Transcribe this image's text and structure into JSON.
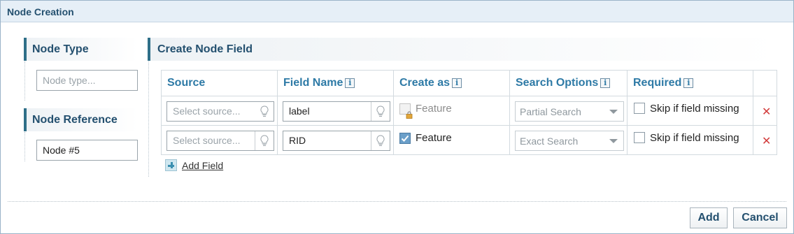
{
  "dialog": {
    "title": "Node Creation"
  },
  "node_type": {
    "heading": "Node Type",
    "input_placeholder": "Node type..."
  },
  "node_reference": {
    "heading": "Node Reference",
    "input_value": "Node #5"
  },
  "create_node_field": {
    "heading": "Create Node Field",
    "columns": [
      "Source",
      "Field Name",
      "Create as",
      "Search Options",
      "Required"
    ],
    "rows": [
      {
        "source_placeholder": "Select source...",
        "field_name": "label",
        "create_as_label": "Feature",
        "create_as_checked": false,
        "create_as_disabled": true,
        "search_option": "Partial Search",
        "required_label": "Skip if field missing",
        "required_checked": false
      },
      {
        "source_placeholder": "Select source...",
        "field_name": "RID",
        "create_as_label": "Feature",
        "create_as_checked": true,
        "create_as_disabled": false,
        "search_option": "Exact Search",
        "required_label": "Skip if field missing",
        "required_checked": false
      }
    ],
    "add_field_label": "Add Field"
  },
  "footer": {
    "add_label": "Add",
    "cancel_label": "Cancel"
  },
  "colors": {
    "heading": "#24506f",
    "column_header": "#2e7aa6",
    "delete": "#d23b3b",
    "checkbox_checked": "#6b9fc9"
  },
  "icons": {
    "info": "info-icon",
    "hint": "lightbulb-icon",
    "lock": "lock-icon",
    "delete": "close-icon",
    "add": "plus-icon"
  }
}
